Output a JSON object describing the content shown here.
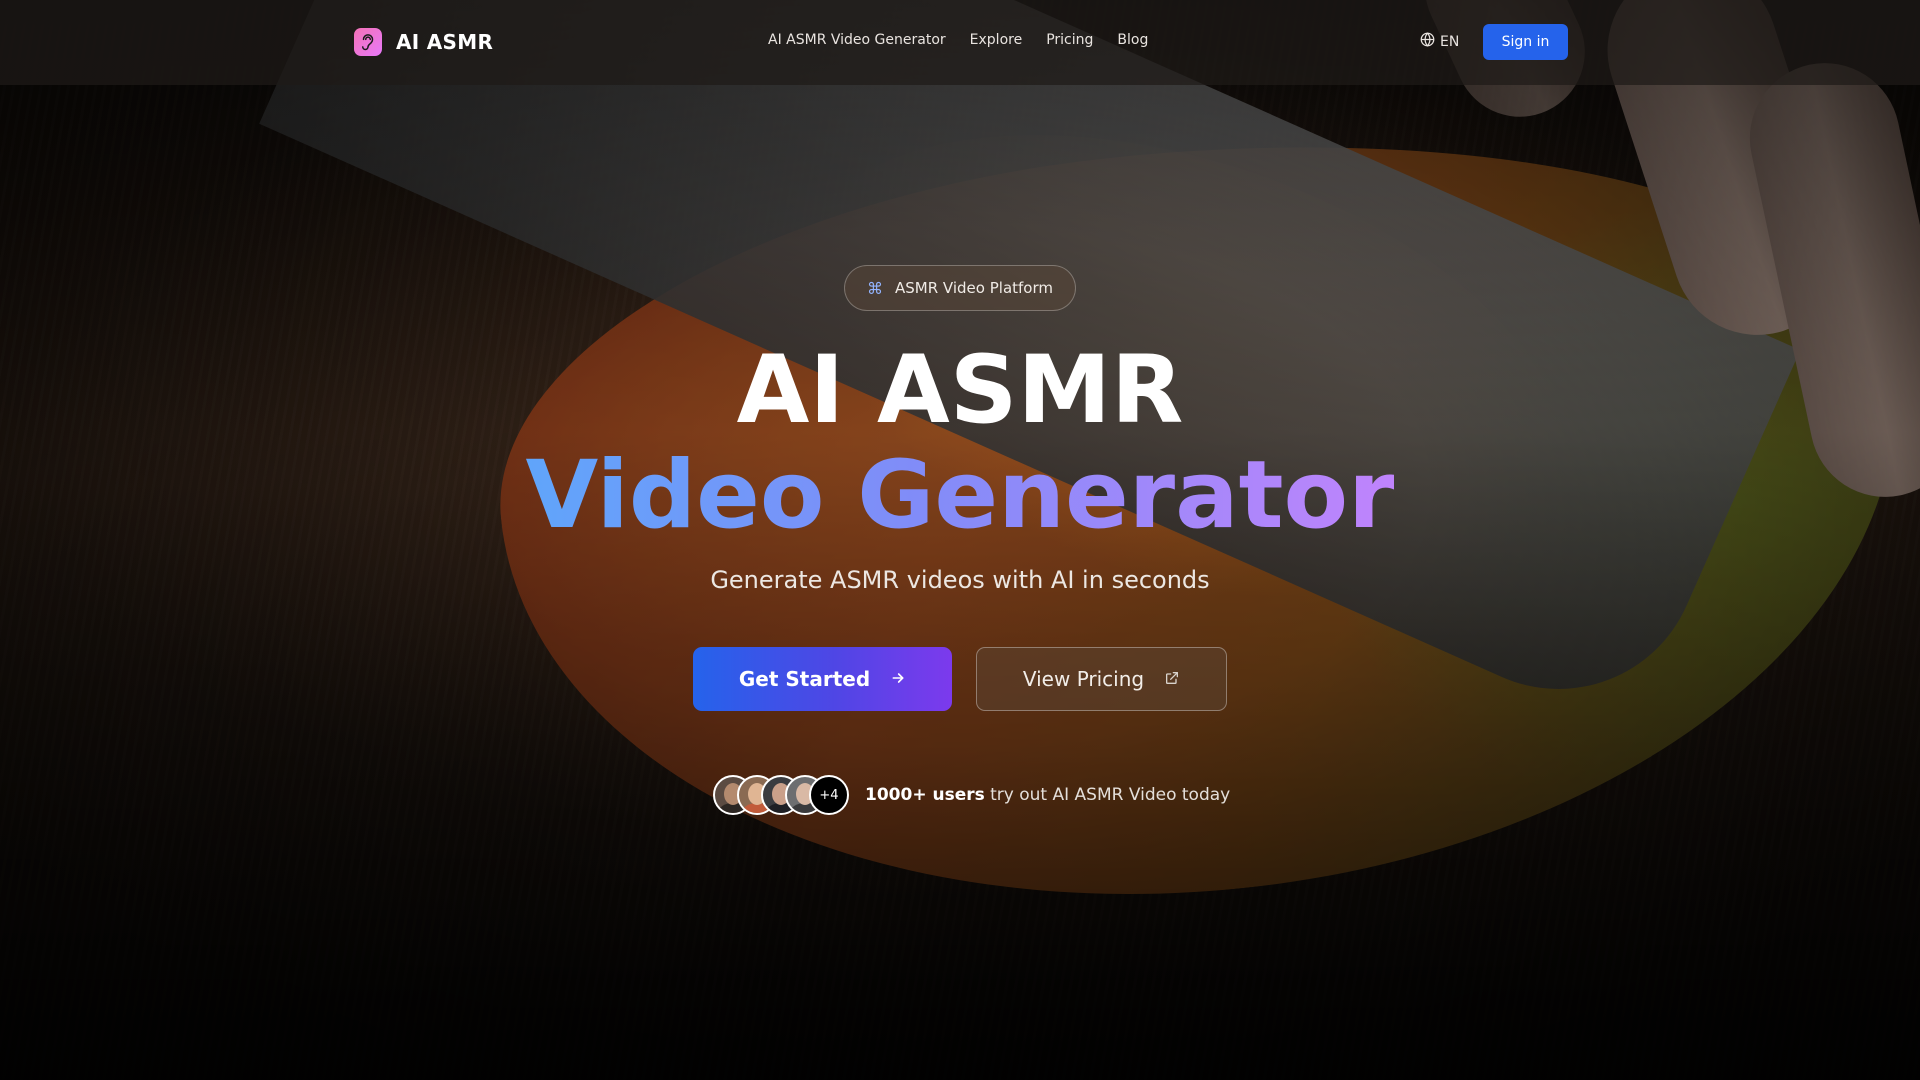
{
  "brand": {
    "name": "AI ASMR",
    "logo_icon": "ear-icon"
  },
  "nav": {
    "items": [
      {
        "label": "AI ASMR Video Generator"
      },
      {
        "label": "Explore"
      },
      {
        "label": "Pricing"
      },
      {
        "label": "Blog"
      }
    ]
  },
  "header": {
    "language": "EN",
    "language_icon": "globe-icon",
    "signin_label": "Sign in"
  },
  "hero": {
    "badge_label": "ASMR Video Platform",
    "badge_icon": "command-icon",
    "title_line1": "AI ASMR",
    "title_line2": "Video Generator",
    "subtitle": "Generate ASMR videos with AI in seconds",
    "primary_cta": "Get Started",
    "secondary_cta": "View Pricing",
    "social_proof": {
      "extra_count": "+4",
      "highlight": "1000+ users",
      "text": "try out AI ASMR Video today"
    }
  },
  "colors": {
    "accent_blue": "#2563eb",
    "gradient_start": "#60a5fa",
    "gradient_end": "#c084fc"
  }
}
